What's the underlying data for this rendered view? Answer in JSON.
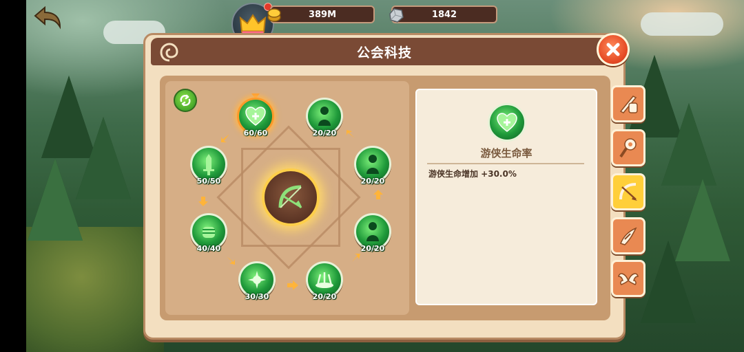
{
  "header": {
    "gold_amount": "389M",
    "stone_amount": "1842"
  },
  "panel": {
    "title": "公会科技"
  },
  "skill_tree": {
    "nodes": [
      {
        "id": "hp",
        "level": "60/60",
        "icon": "heart-plus-icon",
        "selected": true
      },
      {
        "id": "figure-top",
        "level": "20/20",
        "icon": "hero-silhouette-icon",
        "selected": false
      },
      {
        "id": "sword",
        "level": "50/50",
        "icon": "sword-icon",
        "selected": false
      },
      {
        "id": "figure-right",
        "level": "20/20",
        "icon": "hero-silhouette-icon",
        "selected": false
      },
      {
        "id": "fist",
        "level": "40/40",
        "icon": "fist-icon",
        "selected": false
      },
      {
        "id": "figure-lower-right",
        "level": "20/20",
        "icon": "hero-silhouette-icon",
        "selected": false
      },
      {
        "id": "burst",
        "level": "30/30",
        "icon": "burst-icon",
        "selected": false
      },
      {
        "id": "aura",
        "level": "20/20",
        "icon": "aura-icon",
        "selected": false
      }
    ],
    "center_icon": "bow-icon"
  },
  "detail": {
    "name": "游侠生命率",
    "effect": "游侠生命增加  +30.0%",
    "icon": "heart-plus-icon"
  },
  "side_tabs": [
    {
      "id": "warrior",
      "icon": "sword-shield-icon",
      "active": false
    },
    {
      "id": "mage",
      "icon": "staff-icon",
      "active": false
    },
    {
      "id": "ranger",
      "icon": "bow-arrow-icon",
      "active": true
    },
    {
      "id": "assassin",
      "icon": "claw-icon",
      "active": false
    },
    {
      "id": "support",
      "icon": "wings-icon",
      "active": false
    }
  ],
  "colors": {
    "panel_bg": "#f3dfc0",
    "title_bar": "#7a4a35",
    "node_green": "#1f9a3a",
    "selected_orange": "#ff9a2a",
    "tab_orange": "#e98952",
    "tab_active": "#ffcf3a"
  }
}
